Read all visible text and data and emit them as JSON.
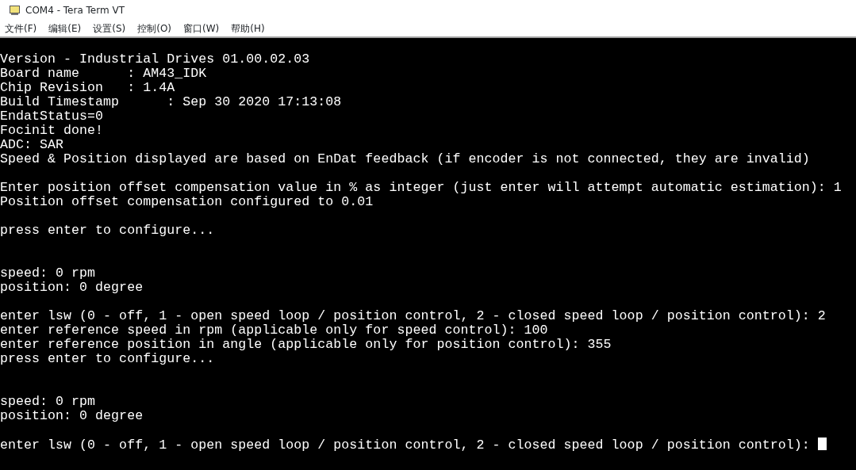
{
  "window": {
    "title": "COM4 - Tera Term VT"
  },
  "menu": [
    "文件(F)",
    "编辑(E)",
    "设置(S)",
    "控制(O)",
    "窗口(W)",
    "帮助(H)"
  ],
  "terminal": {
    "cursor": true,
    "groups": [
      {
        "kind": "one_blank",
        "lines": [
          "Version - Industrial Drives 01.00.02.03",
          "Board name      : AM43_IDK",
          "Chip Revision   : 1.4A",
          "Build Timestamp      : Sep 30 2020 17:13:08",
          "EndatStatus=0",
          "Focinit done!",
          "ADC: SAR",
          "Speed & Position displayed are based on EnDat feedback (if encoder is not connected, they are invalid)"
        ]
      },
      {
        "kind": "one_blank",
        "lines": [
          "Enter position offset compensation value in % as integer (just enter will attempt automatic estimation): 1",
          "Position offset compensation configured to 0.01"
        ]
      },
      {
        "kind": "one_blank",
        "lines": [
          "press enter to configure..."
        ]
      },
      {
        "kind": "two_blanks",
        "lines": [
          "speed: 0 rpm",
          "position: 0 degree"
        ]
      },
      {
        "kind": "one_blank",
        "lines": [
          "enter lsw (0 - off, 1 - open speed loop / position control, 2 - closed speed loop / position control): 2",
          "enter reference speed in rpm (applicable only for speed control): 100",
          "enter reference position in angle (applicable only for position control): 355",
          "press enter to configure..."
        ]
      },
      {
        "kind": "two_blanks",
        "lines": [
          "speed: 0 rpm",
          "position: 0 degree"
        ]
      },
      {
        "kind": "one_blank",
        "lines": [
          "enter lsw (0 - off, 1 - open speed loop / position control, 2 - closed speed loop / position control): "
        ]
      }
    ]
  }
}
